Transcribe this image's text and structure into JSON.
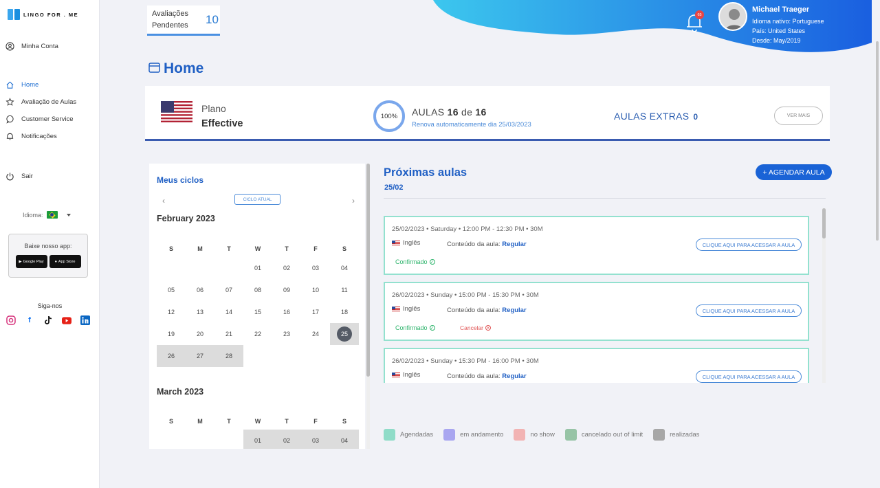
{
  "brand": {
    "name": "LINGO FOR . ME"
  },
  "sidebar": {
    "account": "Minha Conta",
    "items": [
      {
        "label": "Home",
        "icon": "home-icon"
      },
      {
        "label": "Avaliação de Aulas",
        "icon": "star-icon"
      },
      {
        "label": "Customer Service",
        "icon": "chat-icon"
      },
      {
        "label": "Notificações",
        "icon": "bell-icon"
      }
    ],
    "logout": "Sair",
    "language_label": "Idioma:",
    "app_title": "Baixe nosso app:",
    "google_play": "Google Play",
    "app_store": "App Store",
    "follow": "Siga-nos",
    "socials": [
      "instagram-icon",
      "facebook-icon",
      "tiktok-icon",
      "youtube-icon",
      "linkedin-icon"
    ]
  },
  "header": {
    "pending_label": "Avaliações Pendentes",
    "pending_count": "10",
    "notifications_count": "65",
    "user": {
      "name": "Michael Traeger",
      "native": "Idioma nativo: Portuguese",
      "country": "País: United States",
      "since": "Desde: May/2019"
    }
  },
  "page_title": "Home",
  "plan": {
    "label": "Plano",
    "name": "Effective",
    "progress_pct": "100%",
    "progress_value": 1.0,
    "aulas_label": "AULAS",
    "aulas_used": "16",
    "aulas_of": "de",
    "aulas_total": "16",
    "renew": "Renova automaticamente dia 25/03/2023",
    "extras_label": "AULAS EXTRAS",
    "extras_count": "0",
    "more": "VER MAIS"
  },
  "calendar": {
    "title": "Meus ciclos",
    "current_cycle": "CICLO ATUAL",
    "weekdays": [
      "S",
      "M",
      "T",
      "W",
      "T",
      "F",
      "S"
    ],
    "feb_title": "February 2023",
    "feb_days": [
      "",
      "",
      "",
      "01",
      "02",
      "03",
      "04",
      "05",
      "06",
      "07",
      "08",
      "09",
      "10",
      "11",
      "12",
      "13",
      "14",
      "15",
      "16",
      "17",
      "18",
      "19",
      "20",
      "21",
      "22",
      "23",
      "24",
      "25",
      "26",
      "27",
      "28"
    ],
    "mar_title": "March 2023",
    "mar_days": [
      "",
      "",
      "",
      "01",
      "02",
      "03",
      "04"
    ],
    "today": "25"
  },
  "upcoming": {
    "title": "Próximas aulas",
    "date": "25/02",
    "schedule_button": "+ AGENDAR AULA",
    "lessons": [
      {
        "datetime": "25/02/2023 • Saturday • 12:00 PM - 12:30 PM • 30M",
        "language": "Inglês",
        "content_label": "Conteúdo da aula:",
        "content": "Regular",
        "access": "CLIQUE AQUI PARA ACESSAR A AULA",
        "status": "Confirmado",
        "cancel": ""
      },
      {
        "datetime": "26/02/2023 • Sunday • 15:00 PM - 15:30 PM • 30M",
        "language": "Inglês",
        "content_label": "Conteúdo da aula:",
        "content": "Regular",
        "access": "CLIQUE AQUI PARA ACESSAR A AULA",
        "status": "Confirmado",
        "cancel": "Cancelar"
      },
      {
        "datetime": "26/02/2023 • Sunday • 15:30 PM - 16:00 PM • 30M",
        "language": "Inglês",
        "content_label": "Conteúdo da aula:",
        "content": "Regular",
        "access": "CLIQUE AQUI PARA ACESSAR A AULA",
        "status": "",
        "cancel": ""
      }
    ]
  },
  "legend": [
    {
      "label": "Agendadas",
      "color": "#8fdcc8"
    },
    {
      "label": "em andamento",
      "color": "#a9a6f0"
    },
    {
      "label": "no show",
      "color": "#f2b3b3"
    },
    {
      "label": "cancelado out of limit",
      "color": "#97c4a6"
    },
    {
      "label": "realizadas",
      "color": "#a7a7a7"
    }
  ]
}
